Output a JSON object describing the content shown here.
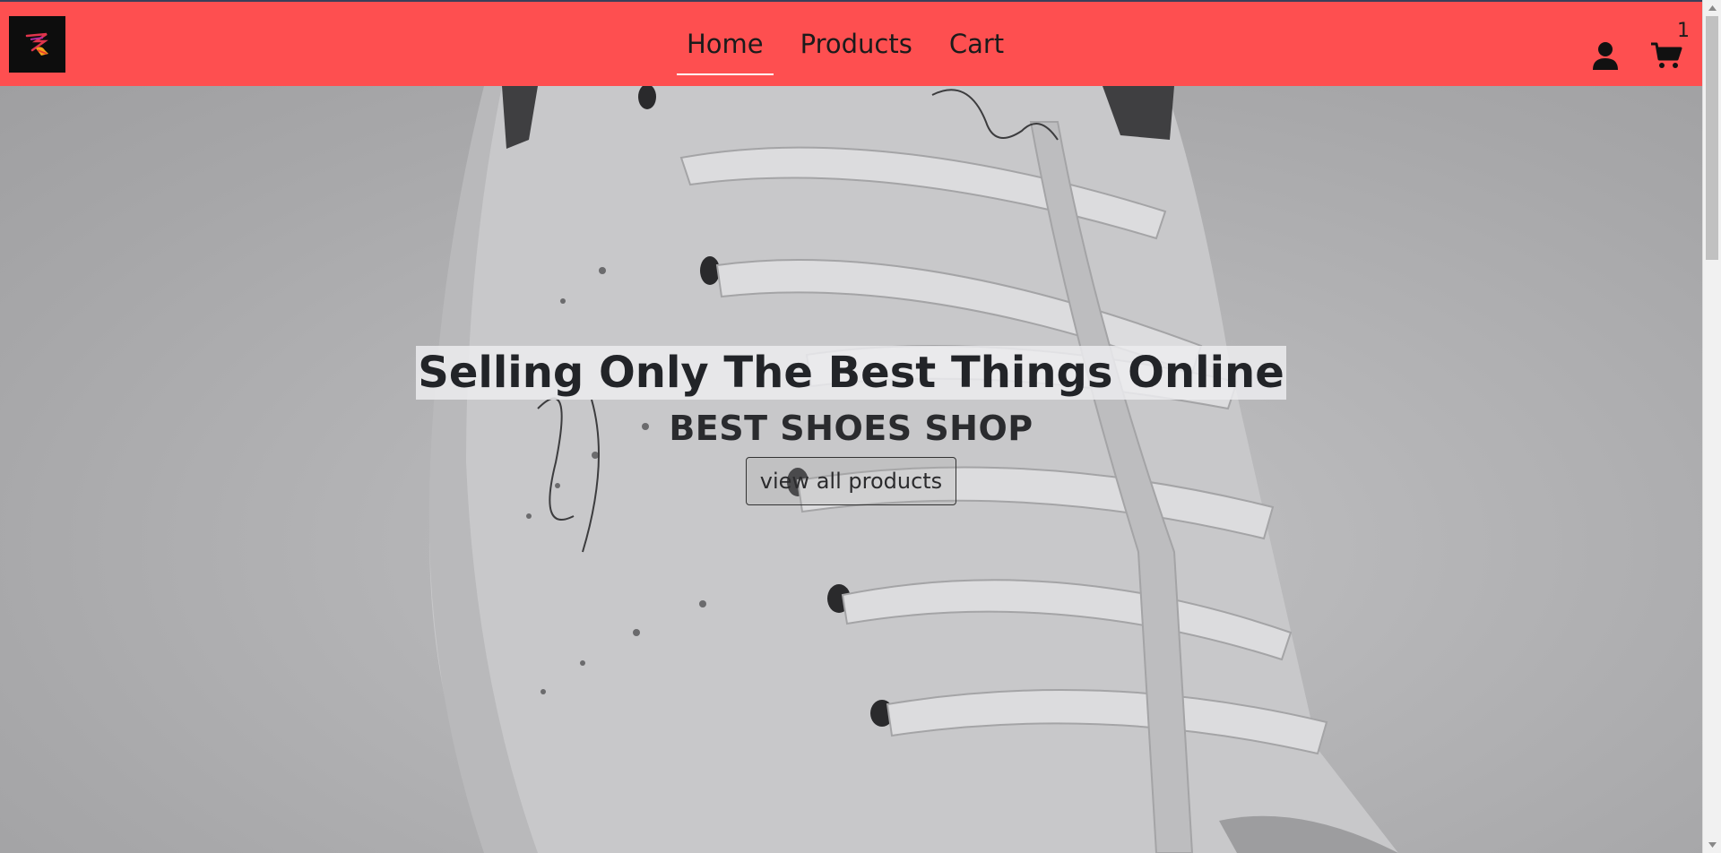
{
  "nav": {
    "links": [
      "Home",
      "Products",
      "Cart"
    ],
    "active": "Home",
    "cart_count": "1",
    "colors": {
      "bar": "#fe4f50"
    }
  },
  "hero": {
    "title": "Selling Only The Best Things Online",
    "subtitle": "BEST SHOES SHOP",
    "cta_label": "view all products"
  },
  "icons": {
    "logo": "shoe-logo-icon",
    "account": "user-icon",
    "cart": "shopping-cart-icon"
  }
}
